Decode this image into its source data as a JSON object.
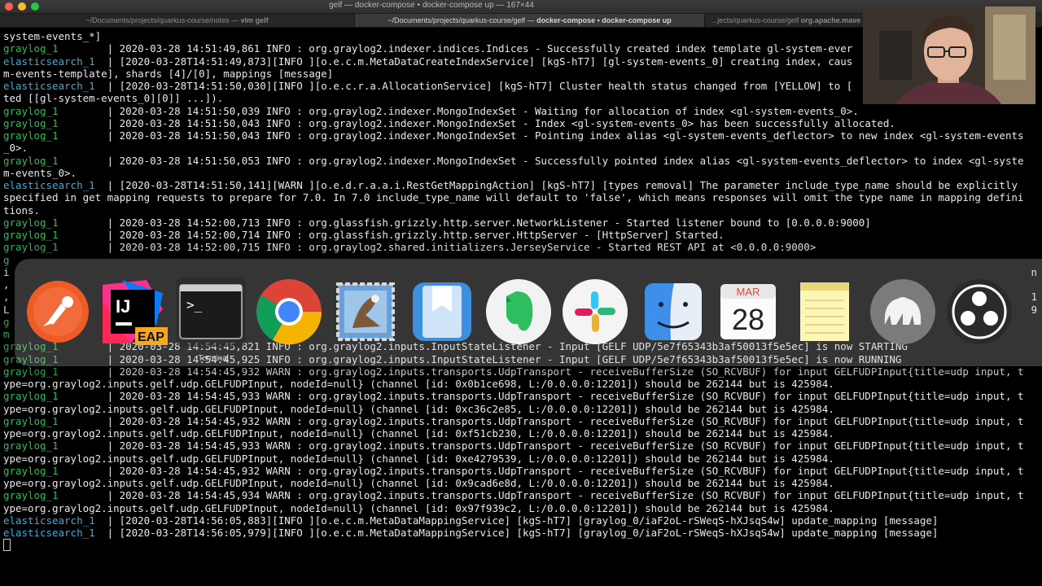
{
  "window": {
    "title": "gelf — docker-compose • docker-compose up — 167×44"
  },
  "tabs": [
    {
      "path": "~/Documents/projects/quarkus-course/notes",
      "sep": " — ",
      "cmd": "vim gelf",
      "active": false
    },
    {
      "path": "~/Documents/projects/quarkus-course/gelf",
      "sep": " — ",
      "cmd": "docker-compose • docker-compose up",
      "active": true
    },
    {
      "path": "...jects/quarkus-course/gelf",
      "sep": " ",
      "cmd": "org.apache.mave",
      "active": false
    }
  ],
  "terminal": {
    "lines": [
      {
        "p": "",
        "t": "system-events_*]"
      },
      {
        "p": "graylog_1        ",
        "t": "| 2020-03-28 14:51:49,861 INFO : org.graylog2.indexer.indices.Indices - Successfully created index template gl-system-ever"
      },
      {
        "p": "elasticsearch_1  ",
        "t": "| [2020-03-28T14:51:49,873][INFO ][o.e.c.m.MetaDataCreateIndexService] [kgS-hT7] [gl-system-events_0] creating index, caus"
      },
      {
        "p": "",
        "t": "m-events-template], shards [4]/[0], mappings [message]"
      },
      {
        "p": "elasticsearch_1  ",
        "t": "| [2020-03-28T14:51:50,030][INFO ][o.e.c.r.a.AllocationService] [kgS-hT7] Cluster health status changed from [YELLOW] to ["
      },
      {
        "p": "",
        "t": "ted [[gl-system-events_0][0]] ...])."
      },
      {
        "p": "graylog_1        ",
        "t": "| 2020-03-28 14:51:50,039 INFO : org.graylog2.indexer.MongoIndexSet - Waiting for allocation of index <gl-system-events_0>."
      },
      {
        "p": "graylog_1        ",
        "t": "| 2020-03-28 14:51:50,043 INFO : org.graylog2.indexer.MongoIndexSet - Index <gl-system-events_0> has been successfully allocated."
      },
      {
        "p": "graylog_1        ",
        "t": "| 2020-03-28 14:51:50,043 INFO : org.graylog2.indexer.MongoIndexSet - Pointing index alias <gl-system-events_deflector> to new index <gl-system-events"
      },
      {
        "p": "",
        "t": "_0>."
      },
      {
        "p": "graylog_1        ",
        "t": "| 2020-03-28 14:51:50,053 INFO : org.graylog2.indexer.MongoIndexSet - Successfully pointed index alias <gl-system-events_deflector> to index <gl-syste"
      },
      {
        "p": "",
        "t": "m-events_0>."
      },
      {
        "p": "elasticsearch_1  ",
        "t": "| [2020-03-28T14:51:50,141][WARN ][o.e.d.r.a.a.i.RestGetMappingAction] [kgS-hT7] [types removal] The parameter include_type_name should be explicitly"
      },
      {
        "p": "",
        "t": "specified in get mapping requests to prepare for 7.0. In 7.0 include_type_name will default to 'false', which means responses will omit the type name in mapping defini"
      },
      {
        "p": "",
        "t": "tions."
      },
      {
        "p": "graylog_1        ",
        "t": "| 2020-03-28 14:52:00,713 INFO : org.glassfish.grizzly.http.server.NetworkListener - Started listener bound to [0.0.0.0:9000]"
      },
      {
        "p": "graylog_1        ",
        "t": "| 2020-03-28 14:52:00,714 INFO : org.glassfish.grizzly.http.server.HttpServer - [HttpServer] Started."
      },
      {
        "p": "graylog_1        ",
        "t": "| 2020-03-28 14:52:00,715 INFO : org.graylog2.shared.initializers.JerseyService - Started REST API at <0.0.0.0:9000>"
      },
      {
        "p": "g",
        "t": ""
      },
      {
        "p": "",
        "t": "i"
      },
      {
        "p": "",
        "t": ","
      },
      {
        "p": "",
        "t": ","
      },
      {
        "p": "",
        "t": "L"
      },
      {
        "p": "g",
        "t": ""
      },
      {
        "p": "m",
        "t": ""
      },
      {
        "p": "graylog_1        ",
        "t": "| 2020-03-28 14:54:45,821 INFO : org.graylog2.inputs.InputStateListener - Input [GELF UDP/5e7f65343b3af50013f5e5ec] is now STARTING"
      },
      {
        "p": "graylog_1        ",
        "t": "| 2020-03-28 14:54:45,925 INFO : org.graylog2.inputs.InputStateListener - Input [GELF UDP/5e7f65343b3af50013f5e5ec] is now RUNNING"
      },
      {
        "p": "graylog_1        ",
        "t": "| 2020-03-28 14:54:45,932 WARN : org.graylog2.inputs.transports.UdpTransport - receiveBufferSize (SO_RCVBUF) for input GELFUDPInput{title=udp input, t"
      },
      {
        "p": "",
        "t": "ype=org.graylog2.inputs.gelf.udp.GELFUDPInput, nodeId=null} (channel [id: 0x0b1ce698, L:/0.0.0.0:12201]) should be 262144 but is 425984."
      },
      {
        "p": "graylog_1        ",
        "t": "| 2020-03-28 14:54:45,933 WARN : org.graylog2.inputs.transports.UdpTransport - receiveBufferSize (SO_RCVBUF) for input GELFUDPInput{title=udp input, t"
      },
      {
        "p": "",
        "t": "ype=org.graylog2.inputs.gelf.udp.GELFUDPInput, nodeId=null} (channel [id: 0xc36c2e85, L:/0.0.0.0:12201]) should be 262144 but is 425984."
      },
      {
        "p": "graylog_1        ",
        "t": "| 2020-03-28 14:54:45,932 WARN : org.graylog2.inputs.transports.UdpTransport - receiveBufferSize (SO_RCVBUF) for input GELFUDPInput{title=udp input, t"
      },
      {
        "p": "",
        "t": "ype=org.graylog2.inputs.gelf.udp.GELFUDPInput, nodeId=null} (channel [id: 0xf51cb230, L:/0.0.0.0:12201]) should be 262144 but is 425984."
      },
      {
        "p": "graylog_1        ",
        "t": "| 2020-03-28 14:54:45,933 WARN : org.graylog2.inputs.transports.UdpTransport - receiveBufferSize (SO_RCVBUF) for input GELFUDPInput{title=udp input, t"
      },
      {
        "p": "",
        "t": "ype=org.graylog2.inputs.gelf.udp.GELFUDPInput, nodeId=null} (channel [id: 0xe4279539, L:/0.0.0.0:12201]) should be 262144 but is 425984."
      },
      {
        "p": "graylog_1        ",
        "t": "| 2020-03-28 14:54:45,932 WARN : org.graylog2.inputs.transports.UdpTransport - receiveBufferSize (SO_RCVBUF) for input GELFUDPInput{title=udp input, t"
      },
      {
        "p": "",
        "t": "ype=org.graylog2.inputs.gelf.udp.GELFUDPInput, nodeId=null} (channel [id: 0x9cad6e8d, L:/0.0.0.0:12201]) should be 262144 but is 425984."
      },
      {
        "p": "graylog_1        ",
        "t": "| 2020-03-28 14:54:45,934 WARN : org.graylog2.inputs.transports.UdpTransport - receiveBufferSize (SO_RCVBUF) for input GELFUDPInput{title=udp input, t"
      },
      {
        "p": "",
        "t": "ype=org.graylog2.inputs.gelf.udp.GELFUDPInput, nodeId=null} (channel [id: 0x97f939c2, L:/0.0.0.0:12201]) should be 262144 but is 425984."
      },
      {
        "p": "elasticsearch_1  ",
        "t": "| [2020-03-28T14:56:05,883][INFO ][o.e.c.m.MetaDataMappingService] [kgS-hT7] [graylog_0/iaF2oL-rSWeqS-hXJsqS4w] update_mapping [message]"
      },
      {
        "p": "elasticsearch_1  ",
        "t": "| [2020-03-28T14:56:05,979][INFO ][o.e.c.m.MetaDataMappingService] [kgS-hT7] [graylog_0/iaF2oL-rSWeqS-hXJsqS4w] update_mapping [message]"
      }
    ],
    "right_edge_chars": [
      {
        "row": 19,
        "ch": "n"
      },
      {
        "row": 21,
        "ch": "1"
      },
      {
        "row": 22,
        "ch": "9"
      }
    ]
  },
  "app_switcher": {
    "selected_label": "Terminal",
    "apps": [
      {
        "name": "postman-icon"
      },
      {
        "name": "intellij-idea-eap-icon",
        "badge": "EAP",
        "logo": "IJ"
      },
      {
        "name": "terminal-icon",
        "glyph": ">_"
      },
      {
        "name": "chrome-icon"
      },
      {
        "name": "mail-icon"
      },
      {
        "name": "readkit-icon"
      },
      {
        "name": "evernote-icon"
      },
      {
        "name": "slack-icon"
      },
      {
        "name": "finder-icon"
      },
      {
        "name": "calendar-icon",
        "month": "MAR",
        "day": "28"
      },
      {
        "name": "notes-icon"
      },
      {
        "name": "mamp-icon"
      },
      {
        "name": "obs-icon"
      }
    ]
  },
  "colors": {
    "graylog_prefix": "#2bbd54",
    "elasticsearch_prefix": "#3aaed8",
    "terminal_text": "#e9e9e9",
    "terminal_bg": "#000000"
  }
}
